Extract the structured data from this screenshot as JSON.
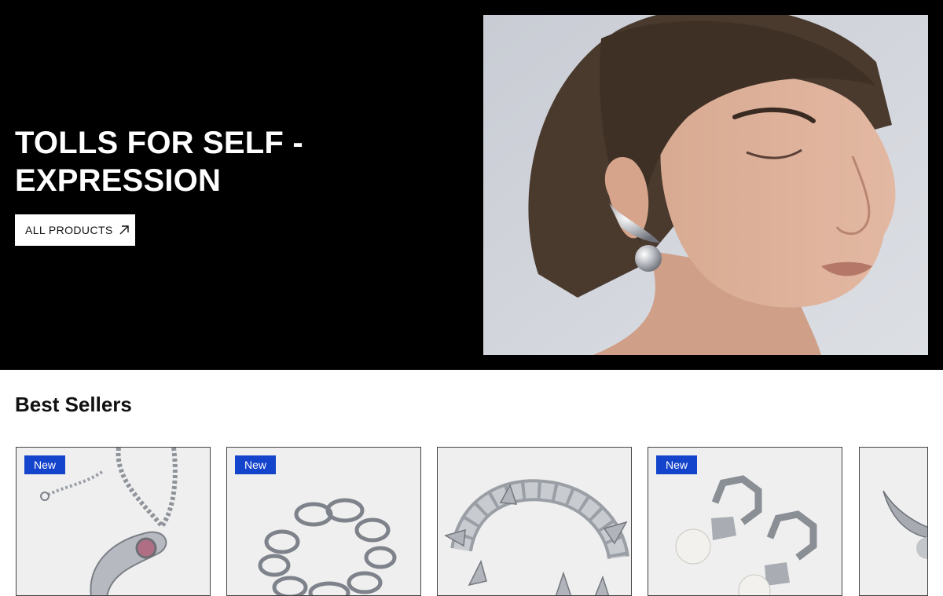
{
  "hero": {
    "title": "TOLLS FOR SELF - EXPRESSION",
    "cta_label": "ALL PRODUCTS",
    "cta_icon": "arrow-up-right-icon",
    "background": "#000000",
    "photo": "model-wearing-silver-earring"
  },
  "best_sellers": {
    "title": "Best Sellers",
    "badge_color": "#1544cc",
    "products": [
      {
        "badge": "New",
        "image": "silver-chain-necklace-pink-stone"
      },
      {
        "badge": "New",
        "image": "silver-chain-link-bracelet"
      },
      {
        "badge": "",
        "image": "silver-spiked-bracelet"
      },
      {
        "badge": "New",
        "image": "silver-pearl-hoop-earrings"
      },
      {
        "badge": "",
        "image": "silver-horn-earring"
      }
    ]
  }
}
